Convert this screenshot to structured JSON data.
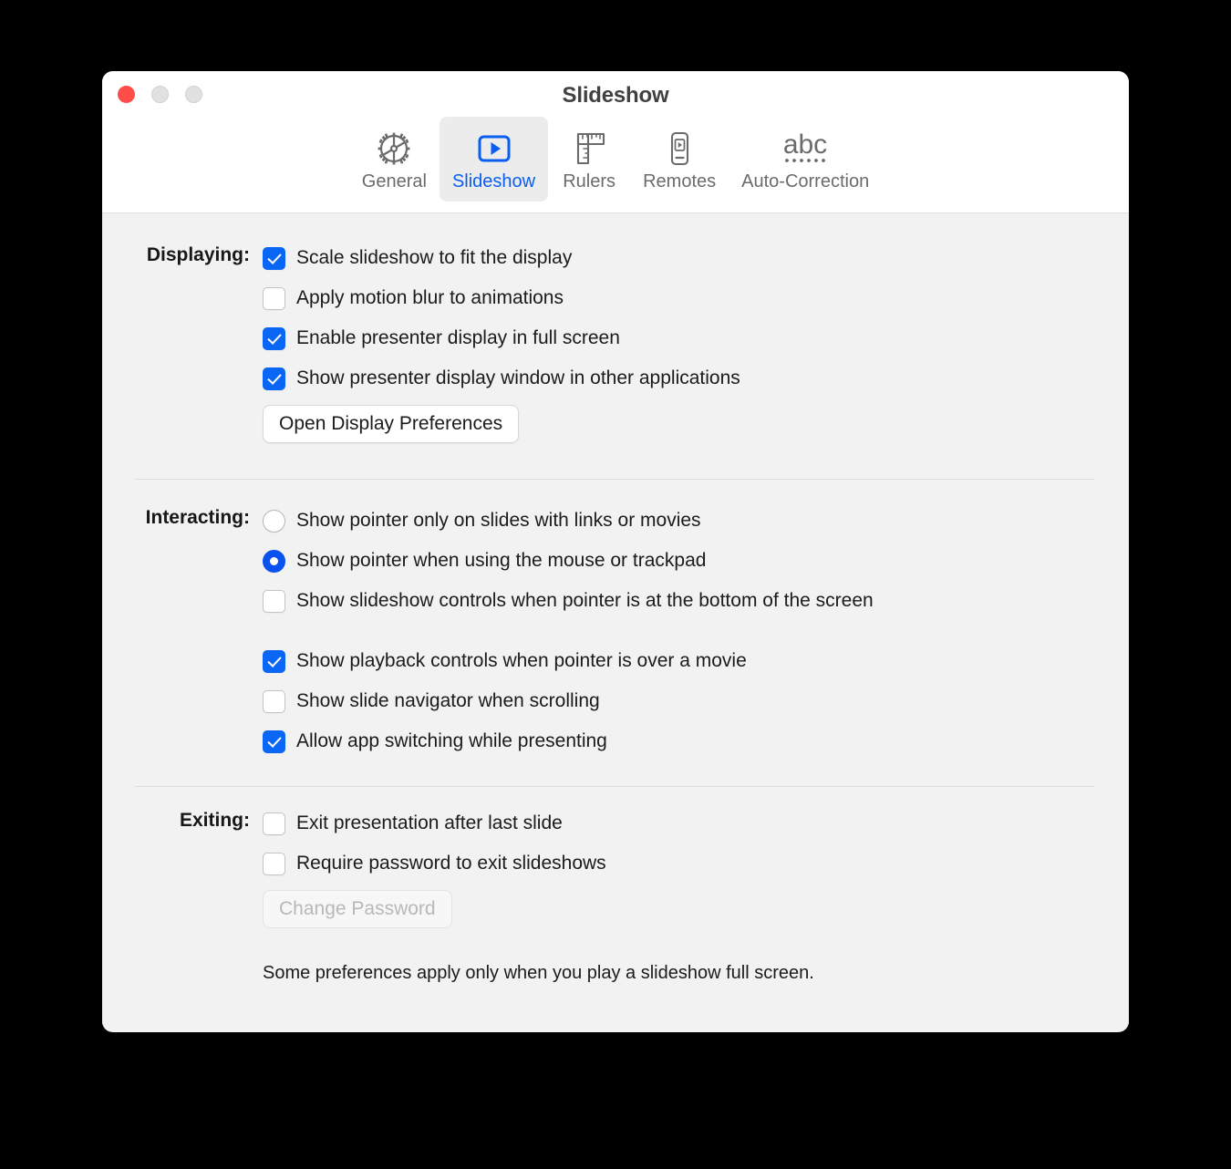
{
  "window": {
    "title": "Slideshow",
    "traffic_lights": [
      "close",
      "minimize",
      "maximize"
    ]
  },
  "toolbar": {
    "tabs": [
      {
        "label": "General",
        "icon": "gear-icon",
        "selected": false
      },
      {
        "label": "Slideshow",
        "icon": "play-rectangle-icon",
        "selected": true
      },
      {
        "label": "Rulers",
        "icon": "ruler-icon",
        "selected": false
      },
      {
        "label": "Remotes",
        "icon": "phone-remote-icon",
        "selected": false
      },
      {
        "label": "Auto-Correction",
        "icon": "abc-spellcheck-icon",
        "selected": false
      }
    ]
  },
  "sections": {
    "displaying": {
      "label": "Displaying:",
      "options": [
        {
          "label": "Scale slideshow to fit the display",
          "checked": true
        },
        {
          "label": "Apply motion blur to animations",
          "checked": false
        },
        {
          "label": "Enable presenter display in full screen",
          "checked": true
        },
        {
          "label": "Show presenter display window in other applications",
          "checked": true
        }
      ],
      "button": {
        "label": "Open Display Preferences",
        "enabled": true
      }
    },
    "interacting": {
      "label": "Interacting:",
      "radios": [
        {
          "label": "Show pointer only on slides with links or movies",
          "selected": false
        },
        {
          "label": "Show pointer when using the mouse or trackpad",
          "selected": true
        }
      ],
      "checkbox_after_radios": {
        "label": "Show slideshow controls when pointer is at the bottom of the screen",
        "checked": false
      },
      "options": [
        {
          "label": "Show playback controls when pointer is over a movie",
          "checked": true
        },
        {
          "label": "Show slide navigator when scrolling",
          "checked": false
        },
        {
          "label": "Allow app switching while presenting",
          "checked": true
        }
      ]
    },
    "exiting": {
      "label": "Exiting:",
      "options": [
        {
          "label": "Exit presentation after last slide",
          "checked": false
        },
        {
          "label": "Require password to exit slideshows",
          "checked": false
        }
      ],
      "button": {
        "label": "Change Password",
        "enabled": false
      }
    }
  },
  "footnote": "Some preferences apply only when you play a slideshow full screen.",
  "colors": {
    "accent_blue": "#0a66f5",
    "tab_selected_blue": "#0a5ef0",
    "window_bg": "#f2f2f2",
    "toolbar_bg": "#ffffff",
    "close_red": "#ff4d4a"
  }
}
